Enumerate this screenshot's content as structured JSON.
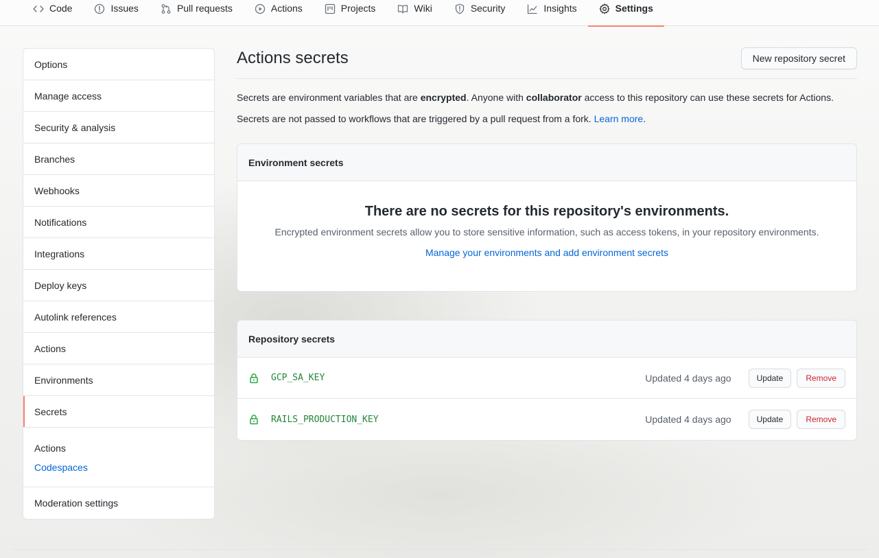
{
  "nav": {
    "tabs": [
      {
        "label": "Code",
        "icon": "code-icon"
      },
      {
        "label": "Issues",
        "icon": "issue-icon"
      },
      {
        "label": "Pull requests",
        "icon": "pull-request-icon"
      },
      {
        "label": "Actions",
        "icon": "play-icon"
      },
      {
        "label": "Projects",
        "icon": "project-icon"
      },
      {
        "label": "Wiki",
        "icon": "book-icon"
      },
      {
        "label": "Security",
        "icon": "shield-icon"
      },
      {
        "label": "Insights",
        "icon": "graph-icon"
      },
      {
        "label": "Settings",
        "icon": "gear-icon"
      }
    ],
    "selected": "Settings",
    "accent_color": "#f9826c"
  },
  "sidebar": {
    "items": [
      {
        "label": "Options"
      },
      {
        "label": "Manage access"
      },
      {
        "label": "Security & analysis"
      },
      {
        "label": "Branches"
      },
      {
        "label": "Webhooks"
      },
      {
        "label": "Notifications"
      },
      {
        "label": "Integrations"
      },
      {
        "label": "Deploy keys"
      },
      {
        "label": "Autolink references"
      },
      {
        "label": "Actions"
      },
      {
        "label": "Environments"
      },
      {
        "label": "Secrets"
      }
    ],
    "selected": "Secrets",
    "sub": {
      "heading": "Actions",
      "link": "Codespaces"
    },
    "last": "Moderation settings"
  },
  "main": {
    "title": "Actions secrets",
    "new_button": "New repository secret",
    "desc1": {
      "a": "Secrets are environment variables that are ",
      "b": "encrypted",
      "c": ". Anyone with ",
      "d": "collaborator",
      "e": " access to this repository can use these secrets for Actions."
    },
    "desc2": {
      "a": "Secrets are not passed to workflows that are triggered by a pull request from a fork. ",
      "link": "Learn more",
      "end": "."
    },
    "environment": {
      "header": "Environment secrets",
      "blank_title": "There are no secrets for this repository's environments.",
      "blank_sub": "Encrypted environment secrets allow you to store sensitive information, such as access tokens, in your repository environments.",
      "blank_link": "Manage your environments and add environment secrets"
    },
    "repository": {
      "header": "Repository secrets",
      "secrets": [
        {
          "name": "GCP_SA_KEY",
          "updated": "Updated 4 days ago",
          "update": "Update",
          "remove": "Remove"
        },
        {
          "name": "RAILS_PRODUCTION_KEY",
          "updated": "Updated 4 days ago",
          "update": "Update",
          "remove": "Remove"
        }
      ]
    }
  }
}
